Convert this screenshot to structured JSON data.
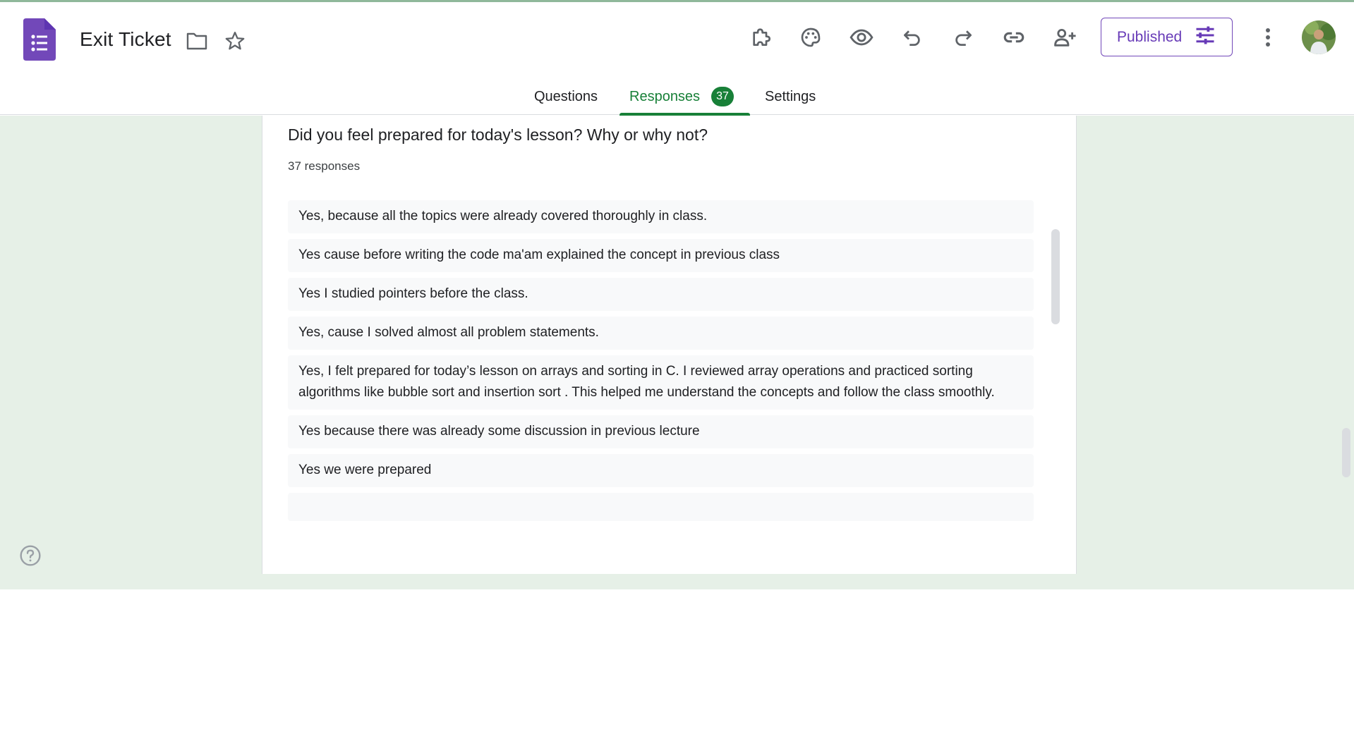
{
  "colors": {
    "brand_purple": "#673ab7",
    "tab_active_green": "#188038",
    "background_tint": "#e6f0e7"
  },
  "header": {
    "app_icon": "google-forms-icon",
    "title": "Exit Ticket",
    "folder_icon": "folder-icon",
    "star_icon": "star-icon",
    "toolbar_icons": [
      "addons-puzzle-icon",
      "palette-icon",
      "preview-eye-icon",
      "undo-icon",
      "redo-icon",
      "link-icon",
      "add-collaborator-icon",
      "more-vert-icon"
    ],
    "publish_label": "Published",
    "publish_icon": "tune-sliders-icon",
    "avatar_icon": "user-avatar"
  },
  "tabs": [
    {
      "label": "Questions",
      "active": false
    },
    {
      "label": "Responses",
      "active": true,
      "badge": "37"
    },
    {
      "label": "Settings",
      "active": false
    }
  ],
  "question": {
    "title": "Did you feel prepared for today's lesson? Why or why not?",
    "count_text": "37 responses",
    "responses": [
      "Yes, because all the topics were already covered thoroughly in class.",
      "Yes cause before writing the code ma'am explained the concept in previous class",
      "Yes I studied pointers before the class.",
      "Yes, cause I solved almost all problem statements.",
      "Yes, I felt prepared for today’s lesson on arrays and sorting in C. I reviewed array operations and practiced sorting algorithms like bubble sort and insertion sort . This helped me understand the concepts and follow the class smoothly.",
      "Yes because there was already some discussion in previous lecture",
      "Yes we were prepared",
      ""
    ]
  },
  "help_icon": "help-circle-icon"
}
